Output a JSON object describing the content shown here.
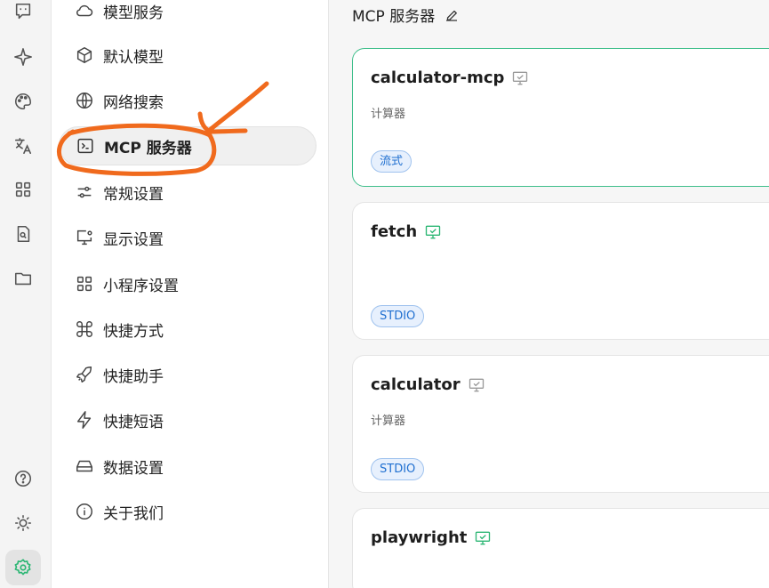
{
  "rail": {
    "icons": [
      "chat-icon",
      "sparkle-icon",
      "palette-icon",
      "translate-icon",
      "apps-icon",
      "document-search-icon",
      "folder-icon",
      "help-icon",
      "theme-icon",
      "settings-icon"
    ]
  },
  "menu": {
    "items": [
      {
        "label": "模型服务",
        "icon": "cloud-icon"
      },
      {
        "label": "默认模型",
        "icon": "cube-icon"
      },
      {
        "label": "网络搜索",
        "icon": "globe-icon"
      },
      {
        "label": "MCP 服务器",
        "icon": "terminal-icon"
      },
      {
        "label": "常规设置",
        "icon": "sliders-icon"
      },
      {
        "label": "显示设置",
        "icon": "monitor-settings-icon"
      },
      {
        "label": "小程序设置",
        "icon": "grid-icon"
      },
      {
        "label": "快捷方式",
        "icon": "command-icon"
      },
      {
        "label": "快捷助手",
        "icon": "rocket-icon"
      },
      {
        "label": "快捷短语",
        "icon": "zap-icon"
      },
      {
        "label": "数据设置",
        "icon": "drive-icon"
      },
      {
        "label": "关于我们",
        "icon": "info-icon"
      }
    ],
    "active_index": 3
  },
  "content": {
    "title": "MCP 服务器",
    "servers": [
      {
        "name": "calculator-mcp",
        "description": "计算器",
        "tag": "流式",
        "status_color": "#9a9a9a"
      },
      {
        "name": "fetch",
        "description": "",
        "tag": "STDIO",
        "status_color": "#2bb673"
      },
      {
        "name": "calculator",
        "description": "计算器",
        "tag": "STDIO",
        "status_color": "#9a9a9a"
      },
      {
        "name": "playwright",
        "description": "",
        "tag": "",
        "status_color": "#2bb673"
      }
    ]
  },
  "colors": {
    "accent": "#3fbf8b",
    "annotation": "#f06a1d",
    "tag_blue": "#1f6fd0"
  }
}
